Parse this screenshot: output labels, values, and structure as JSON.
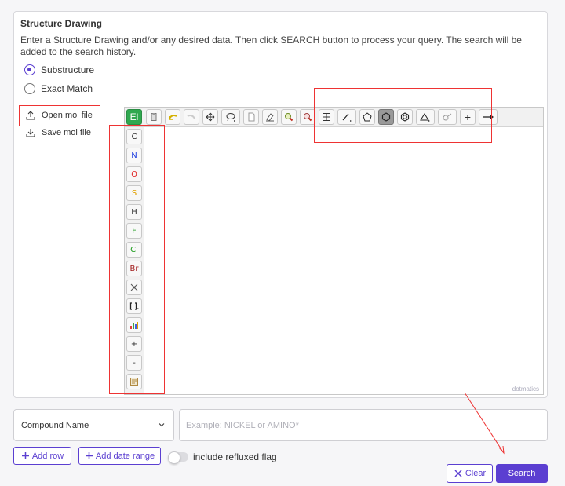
{
  "section": {
    "title": "Structure Drawing",
    "description": "Enter a Structure Drawing and/or any desired data. Then click SEARCH button to process your query. The search will be added to the search history."
  },
  "match_mode": {
    "options": [
      "Substructure",
      "Exact Match"
    ],
    "selected": "Substructure"
  },
  "file_actions": {
    "open_label": "Open mol file",
    "save_label": "Save mol file"
  },
  "editor": {
    "element_button": "El",
    "sidebar_atoms": [
      {
        "label": "C",
        "color": "#222222"
      },
      {
        "label": "N",
        "color": "#1f3fe0"
      },
      {
        "label": "O",
        "color": "#e02020"
      },
      {
        "label": "S",
        "color": "#e0a000"
      },
      {
        "label": "H",
        "color": "#222222"
      },
      {
        "label": "F",
        "color": "#1a9a1a"
      },
      {
        "label": "Cl",
        "color": "#1a9a1a"
      },
      {
        "label": "Br",
        "color": "#a01818"
      }
    ],
    "sidebar_extras": [
      "+",
      "-"
    ],
    "watermark": "dotmatics"
  },
  "query_row": {
    "field_select": "Compound Name",
    "placeholder": "Example: NICKEL or AMINO*"
  },
  "actions": {
    "add_row": "Add row",
    "add_date_range": "Add date range",
    "include_flag": "include refluxed flag",
    "clear": "Clear",
    "search": "Search"
  },
  "colors": {
    "accent": "#5b3fd1",
    "annotation_red": "#e33333"
  }
}
